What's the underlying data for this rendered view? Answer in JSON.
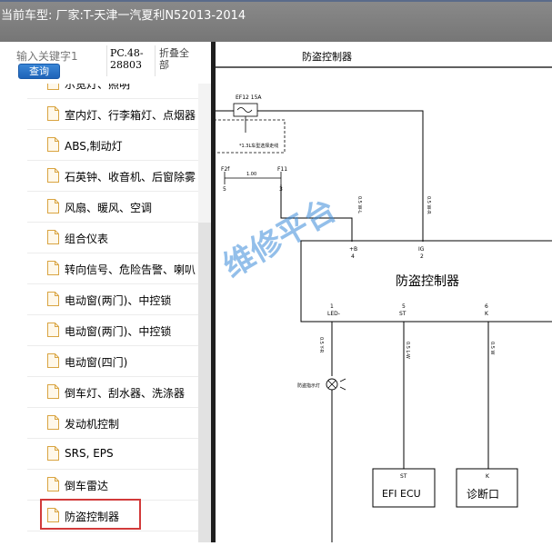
{
  "window": {
    "title": "当前车型:   厂家:T-天津一汽夏利N52013-2014"
  },
  "toolbar": {
    "search_placeholder": "输入关键字1",
    "search_button": "查询",
    "pc_code": "PC.48-28803",
    "fold_all": "折叠全部"
  },
  "tree": {
    "items": [
      {
        "label": "示宽灯、照明"
      },
      {
        "label": "室内灯、行李箱灯、点烟器"
      },
      {
        "label": "ABS,制动灯"
      },
      {
        "label": "石英钟、收音机、后窗除雾"
      },
      {
        "label": "风扇、暖风、空调"
      },
      {
        "label": "组合仪表"
      },
      {
        "label": "转向信号、危险告警、喇叭"
      },
      {
        "label": "电动窗(两门)、中控锁"
      },
      {
        "label": "电动窗(两门)、中控锁"
      },
      {
        "label": "电动窗(四门)"
      },
      {
        "label": "倒车灯、刮水器、洗涤器"
      },
      {
        "label": "发动机控制"
      },
      {
        "label": "SRS, EPS"
      },
      {
        "label": "倒车雷达"
      },
      {
        "label": "防盗控制器"
      }
    ],
    "selected_index": 14
  },
  "diagram": {
    "title": "防盗控制器",
    "watermark": "维修平台",
    "fuse_label": "EF12 15A",
    "dashed_note": "*1.3L车型选择走线",
    "left_conn_label": "F2f",
    "left_conn_pin": "5",
    "mid_conn_label": "F11",
    "mid_conn_pin": "3",
    "wire_spec_short": "1.00",
    "wire_spec_a": "0.5 W-L",
    "wire_spec_b": "0.5 W-R",
    "wire_spec_c": "0.5 Y-R",
    "wire_spec_d": "0.5 L-W",
    "wire_spec_e": "0.5 W",
    "controller_label": "防盗控制器",
    "pin_b_label": "+B",
    "pin_b_num": "4",
    "pin_ig_label": "IG",
    "pin_ig_num": "2",
    "pin_led_num": "1",
    "pin_led_label": "LED-",
    "pin_st_num": "5",
    "pin_st_label": "ST",
    "pin_k_num": "6",
    "pin_k_label": "K",
    "indicator_label": "防盗指示灯",
    "ecu_pin": "ST",
    "ecu_label": "EFI ECU",
    "diag_pin": "K",
    "diag_label": "诊断口"
  },
  "colors": {
    "highlight_border": "#d23a3a",
    "search_button_bg": "#1e63b8",
    "title_bar_bg": "#808080"
  }
}
